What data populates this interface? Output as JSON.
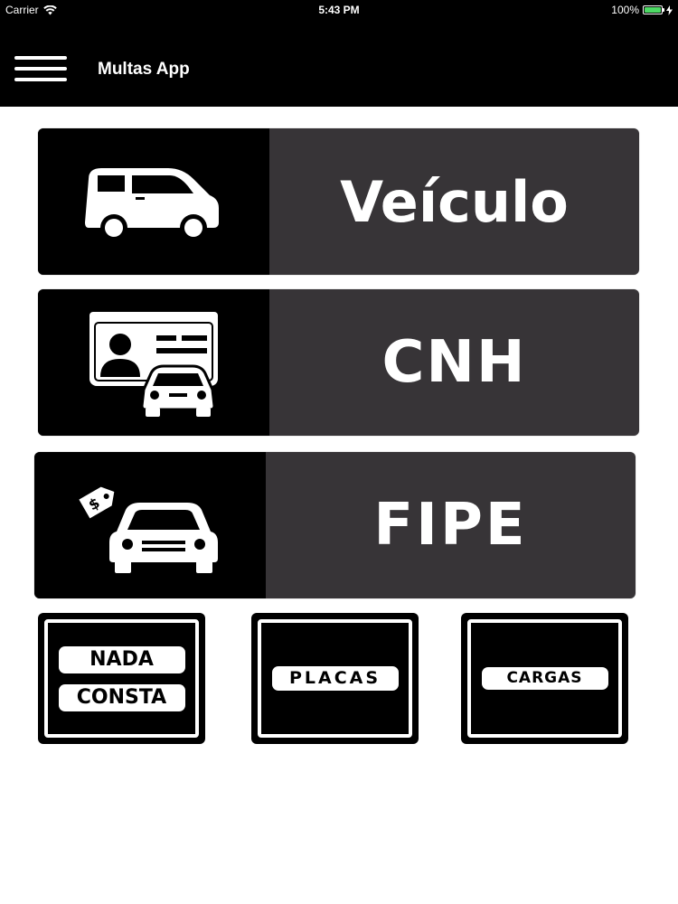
{
  "status_bar": {
    "carrier": "Carrier",
    "time": "5:43 PM",
    "battery": "100%",
    "battery_level": 1.0,
    "icons": [
      "wifi-icon",
      "battery-icon",
      "charging-icon"
    ]
  },
  "nav": {
    "title": "Multas App",
    "menu_icon": "hamburger-menu-icon"
  },
  "tiles": [
    {
      "label": "Veículo",
      "icon": "van-icon"
    },
    {
      "label": "CNH",
      "icon": "driver-license-icon"
    },
    {
      "label": "FIPE",
      "icon": "car-price-tag-icon"
    }
  ],
  "signs": [
    {
      "lines": [
        "NADA",
        "CONSTA"
      ]
    },
    {
      "lines": [
        "PLACAS"
      ]
    },
    {
      "lines": [
        "CARGAS"
      ]
    }
  ],
  "colors": {
    "bar": "#000000",
    "tile_label_bg": "#373437",
    "tile_icon_bg": "#000000",
    "background": "#ffffff",
    "battery": "#4cd964"
  }
}
